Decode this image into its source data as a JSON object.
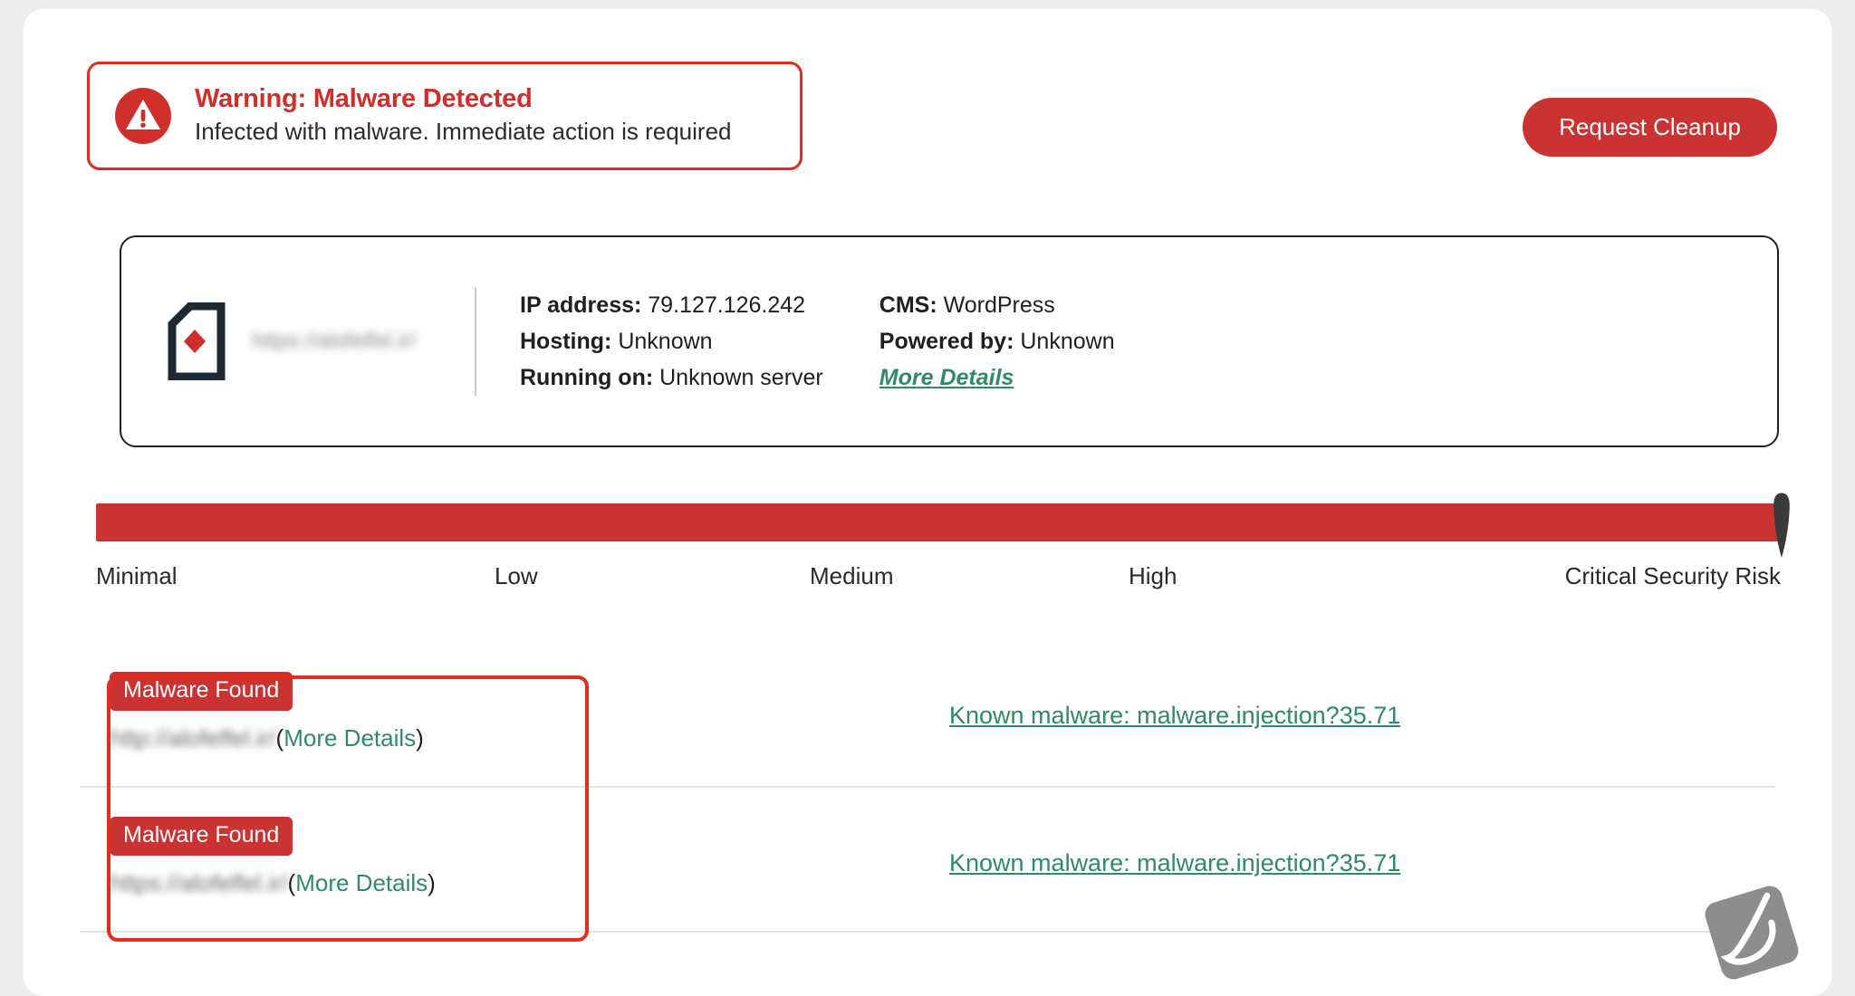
{
  "alert": {
    "icon": "warning-triangle-circle-icon",
    "title": "Warning: Malware Detected",
    "subtitle": "Infected with malware. Immediate action is required",
    "action_label": "Request Cleanup",
    "border_color": "#e02b20",
    "title_color": "#cf2e2a",
    "button_color": "#cb3333"
  },
  "site_info": {
    "logo_icon": "site-shield-document-icon",
    "site_url": "https://alofelfel.ir/",
    "site_url_redacted": true,
    "fields": [
      {
        "label": "IP address:",
        "value": "79.127.126.242"
      },
      {
        "label": "Hosting:",
        "value": "Unknown"
      },
      {
        "label": "Running on:",
        "value": "Unknown server"
      },
      {
        "label": "CMS:",
        "value": "WordPress"
      },
      {
        "label": "Powered by:",
        "value": "Unknown"
      }
    ],
    "more_details_label": "More Details",
    "link_color": "#2e8b65"
  },
  "risk_meter": {
    "levels": [
      "Minimal",
      "Low",
      "Medium",
      "High",
      "Critical Security Risk"
    ],
    "current_level": "Critical Security Risk",
    "fill_percent": 100,
    "bar_color": "#cb3333",
    "pointer_color": "#3a3a3a"
  },
  "findings": {
    "rows": [
      {
        "badge": "Malware Found",
        "url": "http://alofelfel.ir/",
        "url_redacted": true,
        "more_details_open": "(",
        "more_details_label": "More Details",
        "more_details_close": ")",
        "threat": "Known malware: malware.injection?35.71"
      },
      {
        "badge": "Malware Found",
        "url": "https://alofelfel.ir/",
        "url_redacted": true,
        "more_details_open": "(",
        "more_details_label": "More Details",
        "more_details_close": ")",
        "threat": "Known malware: malware.injection?35.71"
      }
    ],
    "badge_color": "#cb3333",
    "highlight_color": "#e42c1f"
  },
  "widget": {
    "icon": "feedback-swoosh-widget-icon",
    "color": "#8d8d8d"
  }
}
